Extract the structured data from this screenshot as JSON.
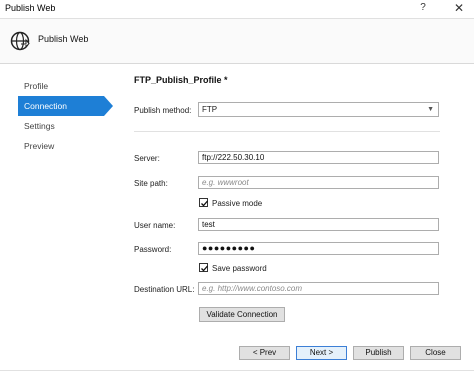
{
  "window": {
    "title": "Publish Web",
    "help": "?",
    "close": "✕"
  },
  "header": {
    "title": "Publish Web",
    "icon": "globe-publish-icon"
  },
  "nav": {
    "items": [
      {
        "label": "Profile"
      },
      {
        "label": "Connection"
      },
      {
        "label": "Settings"
      },
      {
        "label": "Preview"
      }
    ],
    "active": "Connection"
  },
  "form": {
    "profile_title": "FTP_Publish_Profile *",
    "publish_method_label": "Publish method:",
    "publish_method_value": "FTP",
    "server_label": "Server:",
    "server_value": "ftp://222.50.30.10",
    "site_path_label": "Site path:",
    "site_path_placeholder": "e.g. wwwroot",
    "passive_mode_label": "Passive mode",
    "passive_mode_checked": true,
    "user_name_label": "User name:",
    "user_name_value": "test",
    "password_label": "Password:",
    "password_value": "●●●●●●●●●",
    "save_password_label": "Save password",
    "save_password_checked": true,
    "destination_url_label": "Destination URL:",
    "destination_url_placeholder": "e.g. http://www.contoso.com",
    "validate_button": "Validate Connection"
  },
  "footer": {
    "prev": "< Prev",
    "next": "Next >",
    "publish": "Publish",
    "close": "Close"
  },
  "colors": {
    "accent": "#1e7fd6"
  }
}
